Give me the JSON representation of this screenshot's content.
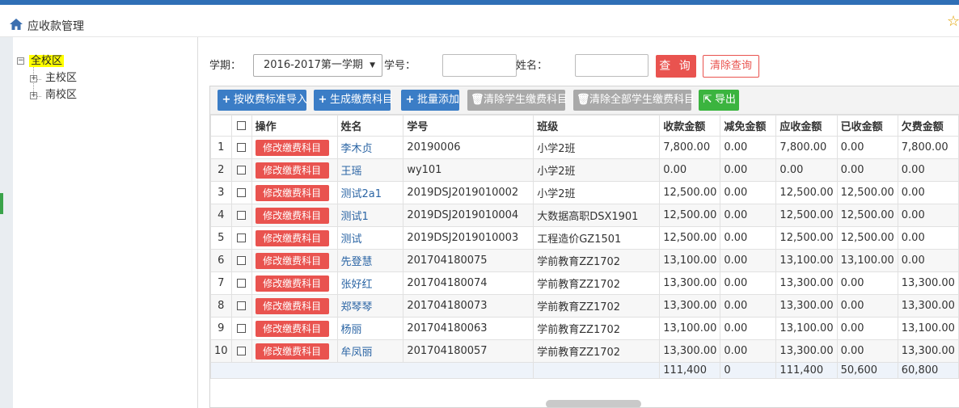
{
  "header": {
    "title": "应收款管理"
  },
  "tree": {
    "root": "全校区",
    "children": [
      "主校区",
      "南校区"
    ]
  },
  "search": {
    "term_label": "学期：",
    "term_value": "2016-2017第一学期",
    "student_no_label": "学号：",
    "student_no_value": "",
    "name_label": "姓名：",
    "name_value": "",
    "query_button": "查 询",
    "clear_button": "清除查询"
  },
  "toolbar": {
    "import_standard": "按收费标准导入",
    "generate_items": "生成缴费科目",
    "batch_add": "批量添加",
    "clear_student_items": "清除学生缴费科目",
    "clear_all_student_items": "清除全部学生缴费科目",
    "export": "导出"
  },
  "table": {
    "headers": [
      "",
      "",
      "操作",
      "姓名",
      "学号",
      "班级",
      "收款金额",
      "减免金额",
      "应收金额",
      "已收金额",
      "欠费金额"
    ],
    "row_button": "修改缴费科目",
    "rows": [
      [
        "1",
        "李木贞",
        "20190006",
        "小学2班",
        "7,800.00",
        "0.00",
        "7,800.00",
        "0.00",
        "7,800.00"
      ],
      [
        "2",
        "王瑶",
        "wy101",
        "小学2班",
        "0.00",
        "0.00",
        "0.00",
        "0.00",
        "0.00"
      ],
      [
        "3",
        "测试2a1",
        "2019DSJ2019010002",
        "小学2班",
        "12,500.00",
        "0.00",
        "12,500.00",
        "12,500.00",
        "0.00"
      ],
      [
        "4",
        "测试1",
        "2019DSJ2019010004",
        "大数据高职DSX1901",
        "12,500.00",
        "0.00",
        "12,500.00",
        "12,500.00",
        "0.00"
      ],
      [
        "5",
        "测试",
        "2019DSJ2019010003",
        "工程造价GZ1501",
        "12,500.00",
        "0.00",
        "12,500.00",
        "12,500.00",
        "0.00"
      ],
      [
        "6",
        "先登慧",
        "201704180075",
        "学前教育ZZ1702",
        "13,100.00",
        "0.00",
        "13,100.00",
        "13,100.00",
        "0.00"
      ],
      [
        "7",
        "张好红",
        "201704180074",
        "学前教育ZZ1702",
        "13,300.00",
        "0.00",
        "13,300.00",
        "0.00",
        "13,300.00"
      ],
      [
        "8",
        "郑琴琴",
        "201704180073",
        "学前教育ZZ1702",
        "13,300.00",
        "0.00",
        "13,300.00",
        "0.00",
        "13,300.00"
      ],
      [
        "9",
        "杨丽",
        "201704180063",
        "学前教育ZZ1702",
        "13,100.00",
        "0.00",
        "13,100.00",
        "0.00",
        "13,100.00"
      ],
      [
        "10",
        "牟凤丽",
        "201704180057",
        "学前教育ZZ1702",
        "13,300.00",
        "0.00",
        "13,300.00",
        "0.00",
        "13,300.00"
      ]
    ],
    "totals": [
      "111,400",
      "0",
      "111,400",
      "50,600",
      "60,800"
    ]
  },
  "colors": {
    "accent_blue": "#3b7dc6",
    "danger_red": "#e9534f",
    "export_green": "#3bb43f",
    "disabled_gray": "#a9a9a9",
    "link_blue": "#2a64a4",
    "tree_highlight": "#ffff00"
  }
}
